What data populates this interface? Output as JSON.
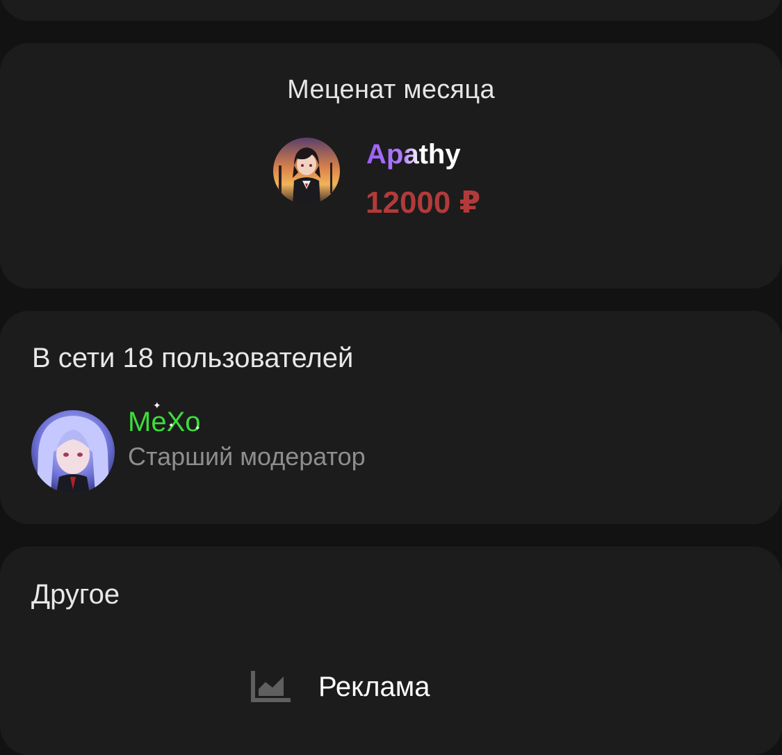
{
  "patron": {
    "title": "Меценат месяца",
    "name_highlight": "Apa",
    "name_rest": "thy",
    "amount": "12000 ₽",
    "colors": {
      "name_accent": "#9b5cf6",
      "amount": "#b33a3a"
    }
  },
  "online": {
    "title": "В сети 18 пользователей",
    "users": [
      {
        "name": "MeXo",
        "role": "Старший модератор",
        "name_color": "#3ddc3d"
      }
    ]
  },
  "other": {
    "title": "Другое",
    "items": [
      {
        "label": "Реклама",
        "icon": "trending-chart-icon"
      }
    ]
  }
}
